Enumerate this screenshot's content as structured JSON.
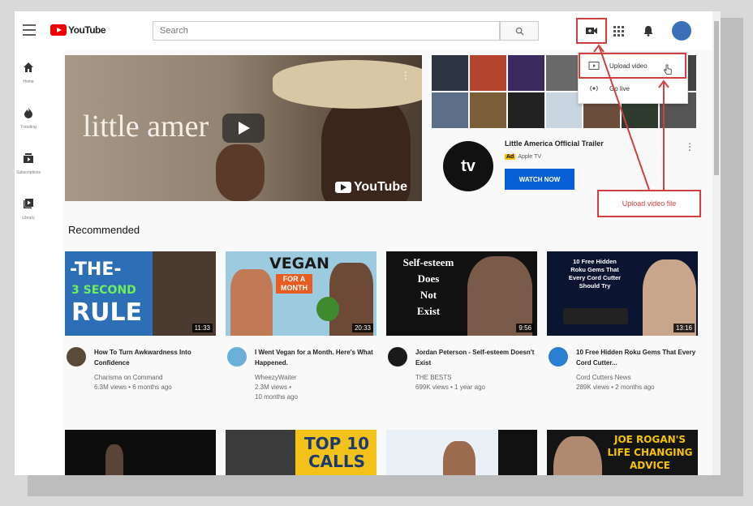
{
  "header": {
    "logo_text": "YouTube",
    "search_placeholder": "Search"
  },
  "sidebar": {
    "items": [
      {
        "label": "Home",
        "icon": "home-icon"
      },
      {
        "label": "Trending",
        "icon": "flame-icon"
      },
      {
        "label": "Subscriptions",
        "icon": "subscriptions-icon"
      },
      {
        "label": "Library",
        "icon": "library-icon"
      }
    ]
  },
  "hero": {
    "title": "little amer",
    "watermark": "YouTube"
  },
  "ad": {
    "logo": "tv",
    "title": "Little America Official Trailer",
    "badge": "Ad",
    "channel": "Apple TV",
    "cta": "WATCH NOW"
  },
  "dropdown": {
    "items": [
      {
        "label": "Upload video",
        "icon": "upload-icon"
      },
      {
        "label": "Go live",
        "icon": "broadcast-icon"
      }
    ]
  },
  "annotation": {
    "text": "Upload video file",
    "color": "#d04040"
  },
  "recommended": {
    "heading": "Recommended",
    "videos": [
      {
        "thumb_text": [
          "-THE-",
          "3 SECOND",
          "RULE"
        ],
        "duration": "11:33",
        "title": "How To Turn Awkwardness Into Confidence",
        "channel": "Charisma on Command",
        "stats": [
          "6.3M views • 6 months ago"
        ]
      },
      {
        "thumb_text": [
          "VEGAN",
          "FOR A",
          "MONTH"
        ],
        "duration": "20:33",
        "title": "I Went Vegan for a Month. Here's What Happened.",
        "channel": "WheezyWaiter",
        "stats": [
          "2.3M views •",
          "10 months ago"
        ]
      },
      {
        "thumb_text": [
          "Self-esteem",
          "Does",
          "Not",
          "Exist"
        ],
        "duration": "9:56",
        "title": "Jordan Peterson - Self-esteem Doesn't Exist",
        "channel": "THE BESTS",
        "stats": [
          "699K views • 1 year ago"
        ]
      },
      {
        "thumb_text": [
          "10 Free Hidden",
          "Roku Gems That",
          "Every Cord Cutter",
          "Should Try"
        ],
        "duration": "13:16",
        "title": "10 Free Hidden Roku Gems That Every Cord Cutter...",
        "channel": "Cord Cutters News",
        "stats": [
          "289K views • 2 months ago"
        ]
      }
    ],
    "row2_thumb_text": [
      "",
      "TOP 10 CALLS",
      "",
      "JOE ROGAN'S LIFE CHANGING ADVICE"
    ]
  },
  "colors": {
    "accent": "#ff0000",
    "cta": "#065fd4",
    "highlight": "#d04040"
  }
}
